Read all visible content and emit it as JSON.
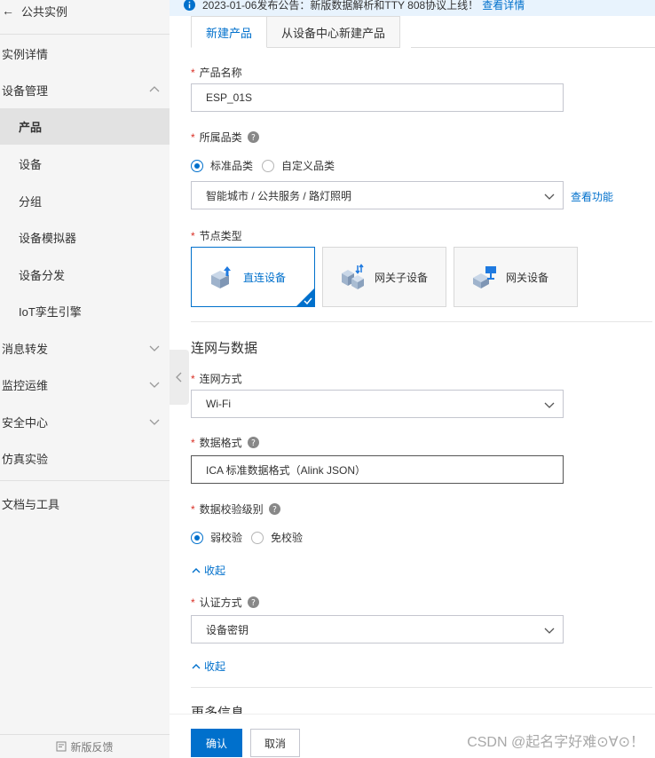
{
  "sidebar": {
    "back_label": "公共实例",
    "items": [
      {
        "label": "实例详情"
      },
      {
        "label": "设备管理"
      },
      {
        "label": "产品"
      },
      {
        "label": "设备"
      },
      {
        "label": "分组"
      },
      {
        "label": "设备模拟器"
      },
      {
        "label": "设备分发"
      },
      {
        "label": "IoT孪生引擎"
      },
      {
        "label": "消息转发"
      },
      {
        "label": "监控运维"
      },
      {
        "label": "安全中心"
      },
      {
        "label": "仿真实验"
      },
      {
        "label": "文档与工具"
      }
    ],
    "feedback": "新版反馈"
  },
  "notice": {
    "text": "2023-01-06发布公告：新版数据解析和TTY 808协议上线！",
    "link": "查看详情"
  },
  "tabs": [
    {
      "label": "新建产品"
    },
    {
      "label": "从设备中心新建产品"
    }
  ],
  "form": {
    "product_name": {
      "label": "产品名称",
      "value": "ESP_01S"
    },
    "category": {
      "label": "所属品类",
      "options": [
        "标准品类",
        "自定义品类"
      ],
      "selected": "智能城市 / 公共服务 / 路灯照明",
      "view_link": "查看功能"
    },
    "node_type": {
      "label": "节点类型",
      "cards": [
        {
          "label": "直连设备"
        },
        {
          "label": "网关子设备"
        },
        {
          "label": "网关设备"
        }
      ]
    },
    "network_section_title": "连网与数据",
    "network": {
      "label": "连网方式",
      "value": "Wi-Fi"
    },
    "data_format": {
      "label": "数据格式",
      "value": "ICA 标准数据格式（Alink JSON）"
    },
    "check_level": {
      "label": "数据校验级别",
      "options": [
        "弱校验",
        "免校验"
      ]
    },
    "collapse_1": "收起",
    "auth": {
      "label": "认证方式",
      "value": "设备密钥"
    },
    "collapse_2": "收起",
    "more_title": "更多信息"
  },
  "footer": {
    "confirm": "确认",
    "cancel": "取消",
    "watermark": "CSDN @起名字好难⊙∀⊙！"
  },
  "colors": {
    "accent": "#0070cc",
    "required": "#d93026"
  }
}
